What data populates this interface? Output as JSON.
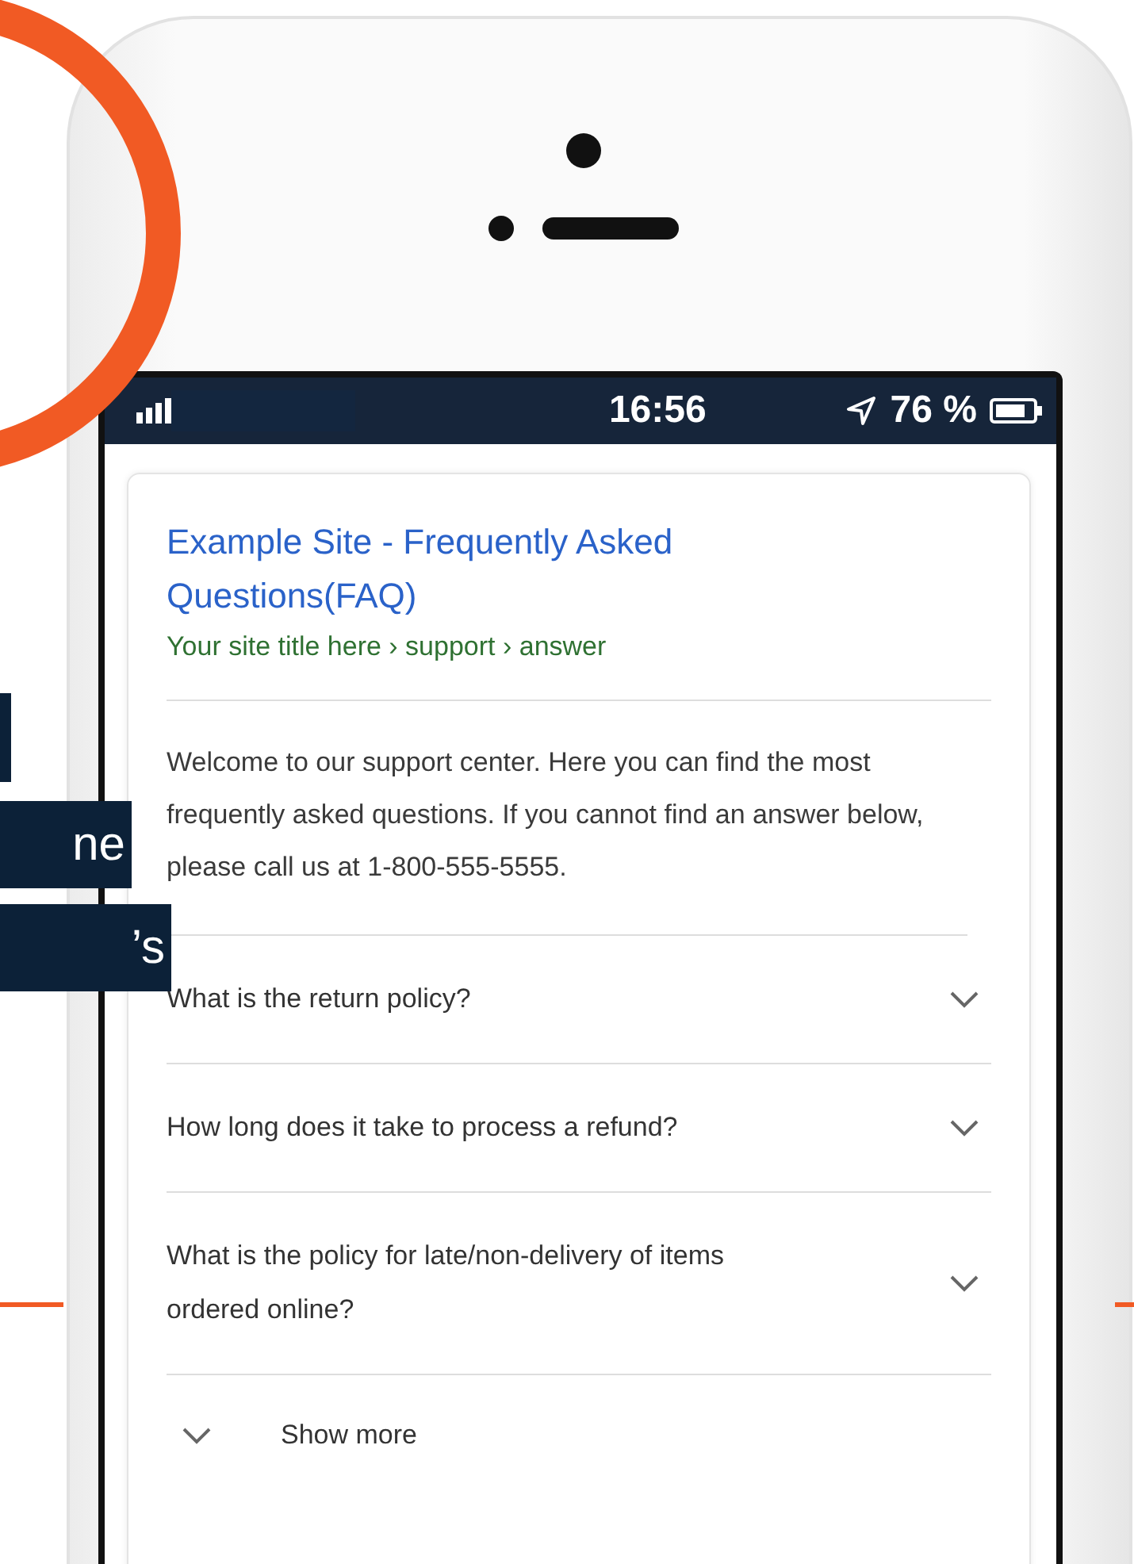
{
  "status_bar": {
    "time": "16:56",
    "battery": "76 %"
  },
  "result": {
    "title": "Example Site - Frequently Asked Questions(FAQ)",
    "breadcrumb": "Your site title here › support › answer",
    "snippet": "Welcome to our support center. Here you can find the most frequently asked questions. If you cannot find an answer below, please call us at 1-800-555-5555."
  },
  "faq": [
    {
      "question": "What is the return policy?",
      "expanded": false
    },
    {
      "question": "How long does it take to process a refund?",
      "expanded": false
    },
    {
      "question": "What is the policy for late/non-delivery of items ordered online?",
      "expanded": false
    }
  ],
  "show_more": "Show more",
  "side_labels": [
    "ne",
    "’s"
  ]
}
